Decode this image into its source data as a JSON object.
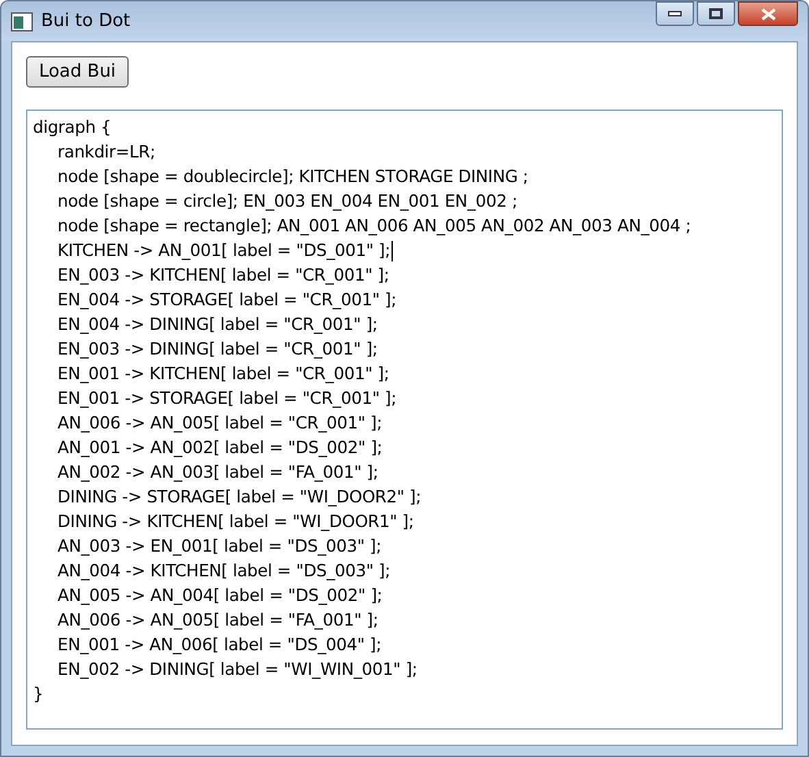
{
  "window": {
    "title": "Bui to Dot"
  },
  "toolbar": {
    "load_button": "Load Bui"
  },
  "editor": {
    "lines": [
      {
        "text": "digraph {",
        "indent": false,
        "caret": false
      },
      {
        "text": "rankdir=LR;",
        "indent": true,
        "caret": false
      },
      {
        "text": "node [shape = doublecircle]; KITCHEN STORAGE DINING ;",
        "indent": true,
        "caret": false
      },
      {
        "text": "node [shape = circle]; EN_003 EN_004 EN_001 EN_002 ;",
        "indent": true,
        "caret": false
      },
      {
        "text": "node [shape = rectangle]; AN_001 AN_006 AN_005 AN_002 AN_003 AN_004 ;",
        "indent": true,
        "caret": false
      },
      {
        "text": "KITCHEN -> AN_001[ label = \"DS_001\" ];",
        "indent": true,
        "caret": true
      },
      {
        "text": "EN_003 -> KITCHEN[ label = \"CR_001\" ];",
        "indent": true,
        "caret": false
      },
      {
        "text": "EN_004 -> STORAGE[ label = \"CR_001\" ];",
        "indent": true,
        "caret": false
      },
      {
        "text": "EN_004 -> DINING[ label = \"CR_001\" ];",
        "indent": true,
        "caret": false
      },
      {
        "text": "EN_003 -> DINING[ label = \"CR_001\" ];",
        "indent": true,
        "caret": false
      },
      {
        "text": "EN_001 -> KITCHEN[ label = \"CR_001\" ];",
        "indent": true,
        "caret": false
      },
      {
        "text": "EN_001 -> STORAGE[ label = \"CR_001\" ];",
        "indent": true,
        "caret": false
      },
      {
        "text": "AN_006 -> AN_005[ label = \"CR_001\" ];",
        "indent": true,
        "caret": false
      },
      {
        "text": "AN_001 -> AN_002[ label = \"DS_002\" ];",
        "indent": true,
        "caret": false
      },
      {
        "text": "AN_002 -> AN_003[ label = \"FA_001\" ];",
        "indent": true,
        "caret": false
      },
      {
        "text": "DINING -> STORAGE[ label = \"WI_DOOR2\" ];",
        "indent": true,
        "caret": false
      },
      {
        "text": "DINING -> KITCHEN[ label = \"WI_DOOR1\" ];",
        "indent": true,
        "caret": false
      },
      {
        "text": "AN_003 -> EN_001[ label = \"DS_003\" ];",
        "indent": true,
        "caret": false
      },
      {
        "text": "AN_004 -> KITCHEN[ label = \"DS_003\" ];",
        "indent": true,
        "caret": false
      },
      {
        "text": "AN_005 -> AN_004[ label = \"DS_002\" ];",
        "indent": true,
        "caret": false
      },
      {
        "text": "AN_006 -> AN_005[ label = \"FA_001\" ];",
        "indent": true,
        "caret": false
      },
      {
        "text": "EN_001 -> AN_006[ label = \"DS_004\" ];",
        "indent": true,
        "caret": false
      },
      {
        "text": "EN_002 -> DINING[ label = \"WI_WIN_001\" ];",
        "indent": true,
        "caret": false
      },
      {
        "text": "}",
        "indent": false,
        "caret": false
      }
    ]
  }
}
